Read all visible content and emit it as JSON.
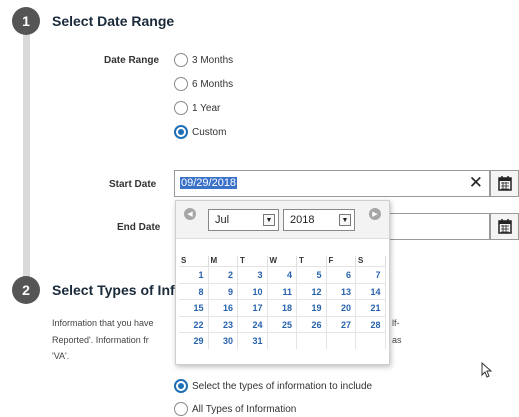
{
  "step1": {
    "number": "1",
    "title": "Select Date Range"
  },
  "date_range": {
    "label": "Date Range",
    "options": [
      "3 Months",
      "6 Months",
      "1 Year",
      "Custom"
    ],
    "selected": "Custom"
  },
  "start_date": {
    "label": "Start Date",
    "value": "09/29/2018",
    "clear_glyph": "✕"
  },
  "end_date": {
    "label": "End Date",
    "value": ""
  },
  "datepicker": {
    "prev_glyph": "◀",
    "next_glyph": "▶",
    "month": "Jul",
    "year": "2018",
    "dropdown_glyph": "▼",
    "days_of_week": [
      "S",
      "M",
      "T",
      "W",
      "T",
      "F",
      "S"
    ],
    "days": [
      "1",
      "2",
      "3",
      "4",
      "5",
      "6",
      "7",
      "8",
      "9",
      "10",
      "11",
      "12",
      "13",
      "14",
      "15",
      "16",
      "17",
      "18",
      "19",
      "20",
      "21",
      "22",
      "23",
      "24",
      "25",
      "26",
      "27",
      "28",
      "29",
      "30",
      "31",
      "",
      "",
      "",
      ""
    ]
  },
  "step2": {
    "number": "2",
    "title": "Select Types of Inf"
  },
  "info": {
    "line1": "Information that you have",
    "line1_right": "lf-",
    "line2": "Reported'. Information fr",
    "line2_right": "as",
    "line3": "'VA'."
  },
  "types": {
    "options": [
      "Select the types of information to include",
      "All Types of Information"
    ],
    "selected": "Select the types of information to include"
  },
  "icons": {
    "calendar": "calendar-icon",
    "cursor": "mouse-cursor-icon",
    "calendar_color": "#222222",
    "accent": "#1f6fb4"
  }
}
